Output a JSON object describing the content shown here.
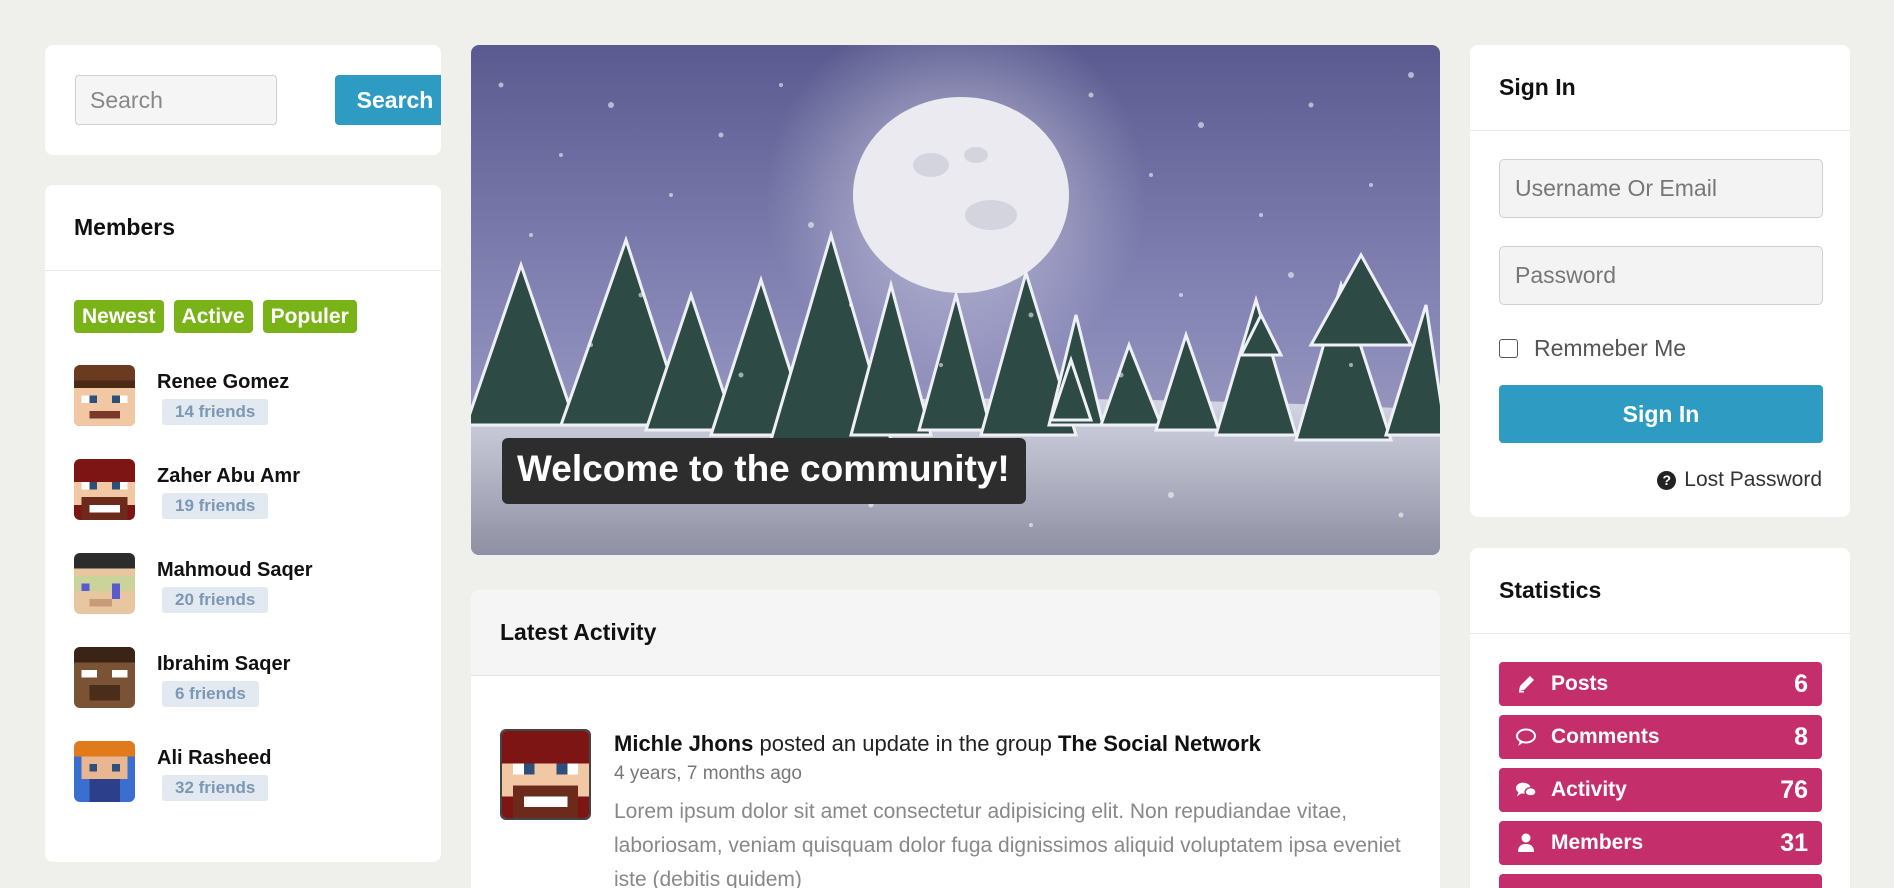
{
  "search": {
    "placeholder": "Search",
    "button_label": "Search"
  },
  "members": {
    "title": "Members",
    "tabs": [
      "Newest",
      "Active",
      "Populer"
    ],
    "list": [
      {
        "name": "Renee Gomez",
        "friends": "14 friends"
      },
      {
        "name": "Zaher Abu Amr",
        "friends": "19 friends"
      },
      {
        "name": "Mahmoud Saqer",
        "friends": "20 friends"
      },
      {
        "name": "Ibrahim Saqer",
        "friends": "6 friends"
      },
      {
        "name": "Ali Rasheed",
        "friends": "32 friends"
      }
    ]
  },
  "hero": {
    "caption": "Welcome to the community!"
  },
  "activity": {
    "title": "Latest Activity",
    "items": [
      {
        "user": "Michle Jhons",
        "action": "posted an update in the group",
        "group": "The Social Network",
        "time": "4 years, 7 months ago",
        "text": "Lorem ipsum dolor sit amet consectetur adipisicing elit. Non repudiandae vitae, laboriosam, veniam quisquam dolor fuga dignissimos aliquid voluptatem ipsa eveniet iste (debitis quidem)"
      }
    ]
  },
  "signin": {
    "title": "Sign In",
    "username_placeholder": "Username Or Email",
    "password_placeholder": "Password",
    "remember_label": "Remmeber Me",
    "button_label": "Sign In",
    "lost_password_label": "Lost Password"
  },
  "statistics": {
    "title": "Statistics",
    "items": [
      {
        "label": "Posts",
        "value": "6",
        "icon": "pencil-icon"
      },
      {
        "label": "Comments",
        "value": "8",
        "icon": "comment-icon"
      },
      {
        "label": "Activity",
        "value": "76",
        "icon": "comments-icon"
      },
      {
        "label": "Members",
        "value": "31",
        "icon": "user-icon"
      }
    ]
  },
  "colors": {
    "background": "#efefeb",
    "accent_blue": "#2e9bc2",
    "tab_green": "#7ab317",
    "stat_pink": "#c42f6b"
  }
}
